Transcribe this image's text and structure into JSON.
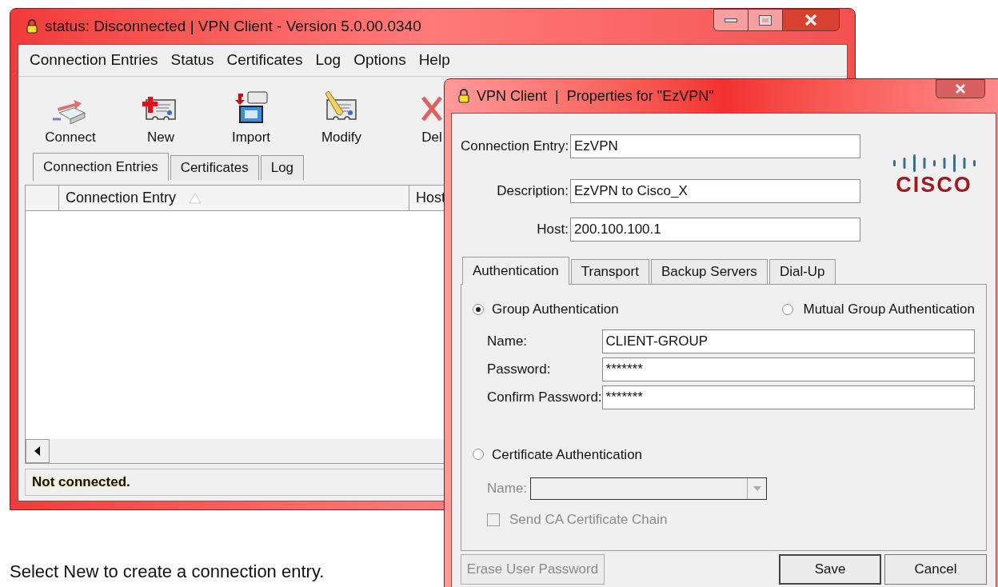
{
  "main_window": {
    "title": "status: Disconnected | VPN Client - Version 5.0.00.0340",
    "menu": [
      "Connection Entries",
      "Status",
      "Certificates",
      "Log",
      "Options",
      "Help"
    ],
    "toolbar": [
      {
        "kind": "connect",
        "label": "Connect"
      },
      {
        "kind": "new",
        "label": "New"
      },
      {
        "kind": "import",
        "label": "Import"
      },
      {
        "kind": "modify",
        "label": "Modify"
      },
      {
        "kind": "delete",
        "label": "Del"
      }
    ],
    "tabs": [
      {
        "label": "Connection Entries",
        "selected": true
      },
      {
        "label": "Certificates",
        "selected": false
      },
      {
        "label": "Log",
        "selected": false
      }
    ],
    "table": {
      "columns": [
        "Connection Entry",
        "Host"
      ]
    },
    "status_bar": "Not connected."
  },
  "dialog": {
    "title": "VPN Client  |  Properties for \"EzVPN\"",
    "fields": [
      {
        "label": "Connection Entry:",
        "value": "EzVPN"
      },
      {
        "label": "Description:",
        "value": "EzVPN to Cisco_X"
      },
      {
        "label": "Host:",
        "value": "200.100.100.1"
      }
    ],
    "logo_text": "CISCO",
    "tabs": [
      {
        "label": "Authentication",
        "selected": true
      },
      {
        "label": "Transport",
        "selected": false
      },
      {
        "label": "Backup Servers",
        "selected": false
      },
      {
        "label": "Dial-Up",
        "selected": false
      }
    ],
    "auth_options": [
      {
        "label": "Group Authentication",
        "selected": true
      },
      {
        "label": "Mutual Group Authentication",
        "selected": false
      },
      {
        "label": "Certificate Authentication",
        "selected": false
      }
    ],
    "group_fields": [
      {
        "label": "Name:",
        "value": "CLIENT-GROUP"
      },
      {
        "label": "Password:",
        "value": "*******"
      },
      {
        "label": "Confirm Password:",
        "value": "*******"
      }
    ],
    "certificate_name": {
      "label": "Name:",
      "disabled": true
    },
    "send_chain": {
      "label": "Send CA Certificate Chain",
      "checked": false,
      "disabled": true
    },
    "buttons": [
      {
        "label": "Erase User Password",
        "disabled": true,
        "default": false
      },
      {
        "label": "Save",
        "disabled": false,
        "default": true
      },
      {
        "label": "Cancel",
        "disabled": false,
        "default": false
      }
    ]
  },
  "caption": "Select New to create a connection entry."
}
